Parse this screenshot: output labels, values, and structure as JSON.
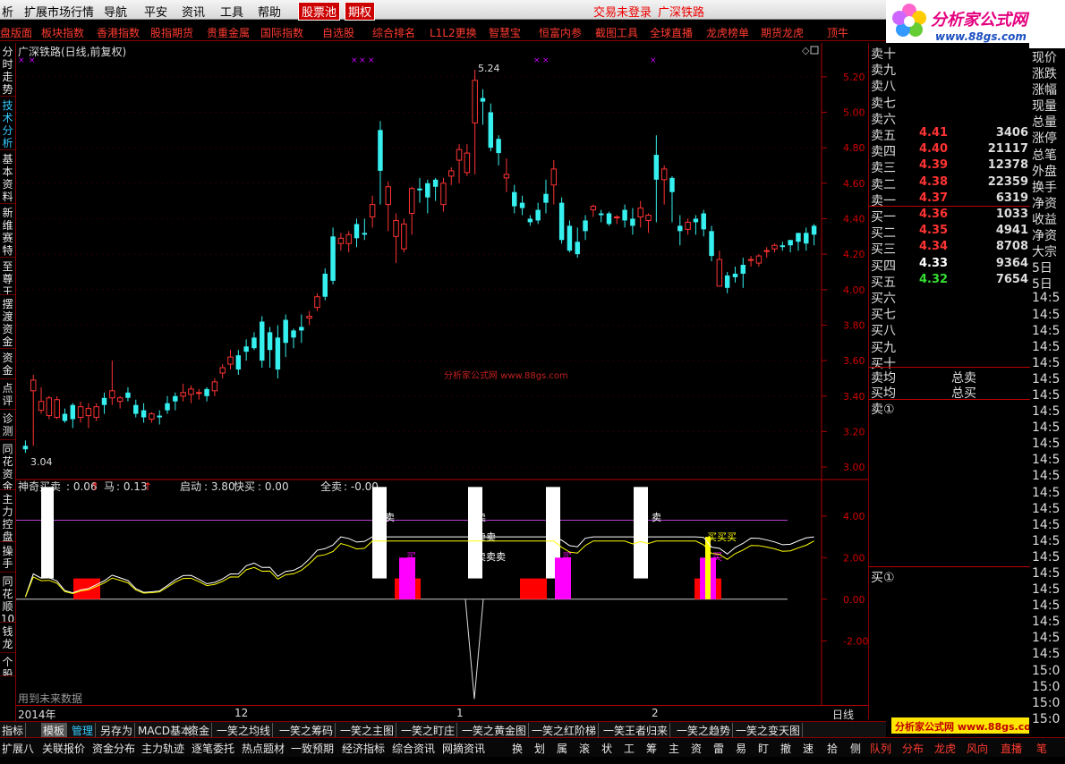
{
  "menu": {
    "items": [
      "析",
      "扩展市场行情",
      "导航",
      "平安",
      "资讯",
      "工具",
      "帮助"
    ],
    "hot1": "股票池",
    "hot2": "期权",
    "status1": "交易未登录",
    "status2": "广深铁路"
  },
  "logo": {
    "title": "分析家公式网",
    "url": "www.88gs.com"
  },
  "toolbar": {
    "items": [
      "盘版面",
      "板块指数",
      "香港指数",
      "股指期货",
      "贵重金属",
      "国际指数",
      "自选股",
      "综合排名",
      "L1L2更换",
      "智慧宝",
      "恒富内参",
      "截图工具",
      "全球直播",
      "龙虎榜单",
      "期货龙虎",
      "顶牛"
    ]
  },
  "lefttabs": [
    "分时走势",
    "技术分析",
    "基本资料",
    "新维赛特",
    "至尊王",
    "摆渡资金",
    "资金",
    "点评",
    "诊测",
    "同花资金",
    "主力控盘",
    "操手",
    "同花顺10",
    "钱龙",
    "个股"
  ],
  "chart": {
    "title": "广深铁路(日线,前复权)",
    "high_label": "5.24",
    "low_label": "3.04",
    "watermark": "分析家公式网 www.88gs.com",
    "price_ticks": [
      "5.20",
      "5.00",
      "4.80",
      "4.60",
      "4.40",
      "4.20",
      "4.00",
      "3.80",
      "3.60",
      "3.40",
      "3.20",
      "3.00"
    ],
    "ind_ticks": [
      "4.00",
      "2.00",
      "0.00",
      "-2.00"
    ],
    "ind_legend": {
      "a_label": "神奇买卖",
      "a_val": ": 0.06",
      "b_label": "马",
      "b_val": ": 0.13",
      "c_label": "启动",
      "c_val": ": 3.80",
      "d_label": "快买",
      "d_val": ": 0.00",
      "e_label": "全卖",
      "e_val": ": -0.00"
    },
    "future_note": "用到未来数据",
    "period": "日线",
    "dates": [
      "2014年",
      "12",
      "1",
      "2"
    ],
    "sig_sell": "卖",
    "sig_sellsell": "卖卖",
    "sig_sss": "卖卖卖",
    "sig_buy": "买",
    "sig_buybuy": "买买",
    "sig_bbb": "买买买"
  },
  "chart_data": {
    "type": "candlestick",
    "ylim": [
      2.95,
      5.3
    ],
    "ohlc": [
      [
        3.12,
        3.1,
        3.15,
        3.08
      ],
      [
        3.43,
        3.49,
        3.52,
        3.12
      ],
      [
        3.32,
        3.37,
        3.45,
        3.3
      ],
      [
        3.29,
        3.39,
        3.4,
        3.27
      ],
      [
        3.28,
        3.38,
        3.4,
        3.27
      ],
      [
        3.3,
        3.26,
        3.33,
        3.25
      ],
      [
        3.35,
        3.27,
        3.36,
        3.22
      ],
      [
        3.28,
        3.34,
        3.37,
        3.25
      ],
      [
        3.29,
        3.33,
        3.36,
        3.22
      ],
      [
        3.28,
        3.34,
        3.36,
        3.26
      ],
      [
        3.39,
        3.35,
        3.42,
        3.3
      ],
      [
        3.39,
        3.43,
        3.6,
        3.35
      ],
      [
        3.37,
        3.39,
        3.4,
        3.33
      ],
      [
        3.42,
        3.39,
        3.45,
        3.37
      ],
      [
        3.35,
        3.3,
        3.38,
        3.28
      ],
      [
        3.32,
        3.28,
        3.36,
        3.25
      ],
      [
        3.27,
        3.3,
        3.31,
        3.25
      ],
      [
        3.29,
        3.28,
        3.32,
        3.24
      ],
      [
        3.36,
        3.32,
        3.4,
        3.3
      ],
      [
        3.4,
        3.37,
        3.42,
        3.32
      ],
      [
        3.4,
        3.42,
        3.47,
        3.37
      ],
      [
        3.41,
        3.44,
        3.46,
        3.36
      ],
      [
        3.42,
        3.42,
        3.44,
        3.38
      ],
      [
        3.44,
        3.4,
        3.45,
        3.37
      ],
      [
        3.43,
        3.48,
        3.5,
        3.4
      ],
      [
        3.53,
        3.56,
        3.58,
        3.5
      ],
      [
        3.58,
        3.62,
        3.66,
        3.55
      ],
      [
        3.63,
        3.55,
        3.66,
        3.52
      ],
      [
        3.68,
        3.65,
        3.72,
        3.6
      ],
      [
        3.73,
        3.67,
        3.76,
        3.66
      ],
      [
        3.82,
        3.6,
        3.85,
        3.56
      ],
      [
        3.76,
        3.66,
        3.79,
        3.56
      ],
      [
        3.73,
        3.55,
        3.8,
        3.5
      ],
      [
        3.83,
        3.7,
        3.86,
        3.62
      ],
      [
        3.77,
        3.73,
        3.78,
        3.67
      ],
      [
        3.79,
        3.77,
        3.86,
        3.7
      ],
      [
        3.84,
        3.85,
        3.88,
        3.8
      ],
      [
        3.9,
        3.96,
        3.98,
        3.88
      ],
      [
        4.09,
        3.96,
        4.12,
        3.94
      ],
      [
        4.3,
        4.05,
        4.35,
        4.03
      ],
      [
        4.26,
        4.29,
        4.32,
        4.22
      ],
      [
        4.26,
        4.31,
        4.33,
        4.21
      ],
      [
        4.37,
        4.29,
        4.4,
        4.24
      ],
      [
        4.32,
        4.31,
        4.4,
        4.28
      ],
      [
        4.41,
        4.48,
        4.53,
        4.35
      ],
      [
        4.9,
        4.67,
        4.95,
        4.48
      ],
      [
        4.48,
        4.58,
        4.61,
        4.33
      ],
      [
        4.3,
        4.39,
        4.43,
        4.15
      ],
      [
        4.23,
        4.37,
        4.4,
        4.21
      ],
      [
        4.43,
        4.57,
        4.58,
        4.31
      ],
      [
        4.57,
        4.56,
        4.63,
        4.49
      ],
      [
        4.6,
        4.52,
        4.62,
        4.43
      ],
      [
        4.62,
        4.58,
        4.63,
        4.5
      ],
      [
        4.48,
        4.6,
        4.63,
        4.44
      ],
      [
        4.64,
        4.67,
        4.69,
        4.59
      ],
      [
        4.73,
        4.79,
        4.82,
        4.6
      ],
      [
        4.66,
        4.77,
        4.82,
        4.64
      ],
      [
        4.94,
        5.18,
        5.24,
        4.65
      ],
      [
        5.08,
        5.06,
        5.13,
        4.93
      ],
      [
        5.0,
        4.8,
        5.05,
        4.78
      ],
      [
        4.85,
        4.77,
        4.87,
        4.7
      ],
      [
        4.63,
        4.65,
        4.74,
        4.55
      ],
      [
        4.55,
        4.47,
        4.59,
        4.43
      ],
      [
        4.49,
        4.46,
        4.53,
        4.42
      ],
      [
        4.4,
        4.38,
        4.42,
        4.36
      ],
      [
        4.45,
        4.39,
        4.49,
        4.37
      ],
      [
        4.54,
        4.49,
        4.62,
        4.43
      ],
      [
        4.59,
        4.68,
        4.73,
        4.48
      ],
      [
        4.49,
        4.28,
        4.52,
        4.26
      ],
      [
        4.36,
        4.22,
        4.39,
        4.21
      ],
      [
        4.27,
        4.2,
        4.35,
        4.18
      ],
      [
        4.39,
        4.33,
        4.42,
        4.28
      ],
      [
        4.45,
        4.47,
        4.48,
        4.41
      ],
      [
        4.43,
        4.42,
        4.45,
        4.38
      ],
      [
        4.43,
        4.37,
        4.44,
        4.36
      ],
      [
        4.41,
        4.41,
        4.42,
        4.37
      ],
      [
        4.45,
        4.39,
        4.48,
        4.35
      ],
      [
        4.4,
        4.36,
        4.46,
        4.31
      ],
      [
        4.41,
        4.46,
        4.5,
        4.35
      ],
      [
        4.39,
        4.42,
        4.43,
        4.32
      ],
      [
        4.76,
        4.62,
        4.87,
        4.38
      ],
      [
        4.62,
        4.68,
        4.7,
        4.48
      ],
      [
        4.63,
        4.55,
        4.64,
        4.38
      ],
      [
        4.36,
        4.33,
        4.42,
        4.25
      ],
      [
        4.34,
        4.38,
        4.4,
        4.31
      ],
      [
        4.4,
        4.38,
        4.42,
        4.31
      ],
      [
        4.43,
        4.34,
        4.45,
        4.3
      ],
      [
        4.33,
        4.19,
        4.36,
        4.16
      ],
      [
        4.02,
        4.17,
        4.22,
        4.02
      ],
      [
        4.08,
        4.01,
        4.1,
        3.98
      ],
      [
        4.09,
        4.07,
        4.13,
        4.04
      ],
      [
        4.14,
        4.09,
        4.18,
        4.01
      ],
      [
        4.17,
        4.17,
        4.19,
        4.13
      ],
      [
        4.15,
        4.19,
        4.2,
        4.13
      ],
      [
        4.22,
        4.22,
        4.24,
        4.18
      ],
      [
        4.23,
        4.25,
        4.26,
        4.21
      ],
      [
        4.25,
        4.24,
        4.27,
        4.22
      ],
      [
        4.28,
        4.25,
        4.28,
        4.21
      ],
      [
        4.32,
        4.27,
        4.32,
        4.22
      ],
      [
        4.32,
        4.26,
        4.35,
        4.22
      ],
      [
        4.36,
        4.31,
        4.37,
        4.25
      ]
    ],
    "ind_ylim": [
      -5,
      5.5
    ]
  },
  "orderbook": {
    "sell": [
      {
        "label": "卖十",
        "price": "",
        "vol": ""
      },
      {
        "label": "卖九",
        "price": "",
        "vol": ""
      },
      {
        "label": "卖八",
        "price": "",
        "vol": ""
      },
      {
        "label": "卖七",
        "price": "",
        "vol": ""
      },
      {
        "label": "卖六",
        "price": "",
        "vol": ""
      },
      {
        "label": "卖五",
        "price": "4.41",
        "vol": "3406"
      },
      {
        "label": "卖四",
        "price": "4.40",
        "vol": "21117"
      },
      {
        "label": "卖三",
        "price": "4.39",
        "vol": "12378"
      },
      {
        "label": "卖二",
        "price": "4.38",
        "vol": "22359"
      },
      {
        "label": "卖一",
        "price": "4.37",
        "vol": "6319"
      }
    ],
    "buy": [
      {
        "label": "买一",
        "price": "4.36",
        "vol": "1033"
      },
      {
        "label": "买二",
        "price": "4.35",
        "vol": "4941"
      },
      {
        "label": "买三",
        "price": "4.34",
        "vol": "8708"
      },
      {
        "label": "买四",
        "price": "4.33",
        "vol": "9364"
      },
      {
        "label": "买五",
        "price": "4.32",
        "vol": "7654"
      },
      {
        "label": "买六",
        "price": "",
        "vol": ""
      },
      {
        "label": "买七",
        "price": "",
        "vol": ""
      },
      {
        "label": "买八",
        "price": "",
        "vol": ""
      },
      {
        "label": "买九",
        "price": "",
        "vol": ""
      },
      {
        "label": "买十",
        "price": "",
        "vol": ""
      }
    ],
    "avg_sell": "卖均",
    "total_sell": "总卖",
    "avg_buy": "买均",
    "total_buy": "总买",
    "sell1": "卖①",
    "buy1": "买①"
  },
  "farright": [
    "现价",
    "涨跌",
    "涨幅",
    "现量",
    "总量",
    "涨停",
    "总笔",
    "外盘",
    "换手",
    "净资",
    "收益",
    "净资",
    "大宗",
    "5日",
    "5日",
    "14:5",
    "14:5",
    "14:5",
    "14:5",
    "14:5",
    "14:5",
    "14:5",
    "14:5",
    "14:5",
    "14:5",
    "14:5",
    "14:5",
    "14:5",
    "14:5",
    "14:5",
    "14:5",
    "14:5",
    "14:5",
    "14:5",
    "14:5",
    "14:5",
    "14:5",
    "14:5",
    "15:0",
    "15:0",
    "15:0",
    "15:0"
  ],
  "detailtabs": [
    "指标",
    "模板",
    "管理",
    "另存为",
    "MACD基本",
    "资金",
    "一笑之均线",
    "一笑之筹码",
    "一笑之主图",
    "一笑之盯庄",
    "一笑之黄金图",
    "一笑之红阶梯",
    "一笑王者归来",
    "一笑之趋势",
    "一笑之变天图"
  ],
  "bottomtabs": [
    "扩展八",
    "关联报价",
    "资金分布",
    "主力轨迹",
    "逐笔委托",
    "热点题材",
    "一致预期",
    "经济指标",
    "综合资讯",
    "网摘资讯",
    "换",
    "划",
    "属",
    "滚",
    "状",
    "工",
    "筹",
    "主",
    "资",
    "雷",
    "易",
    "盯",
    "撤",
    "速",
    "拾",
    "侧",
    "队列",
    "分布",
    "龙虎",
    "风向",
    "直播",
    "笔"
  ],
  "footer_logo": "分析家公式网 www.88gs.com",
  "colors": {
    "up": "#ff3333",
    "down": "#36f0f0",
    "axis": "#b00000",
    "sellprice": "#ff3333",
    "buyprice": "#ff3333"
  }
}
